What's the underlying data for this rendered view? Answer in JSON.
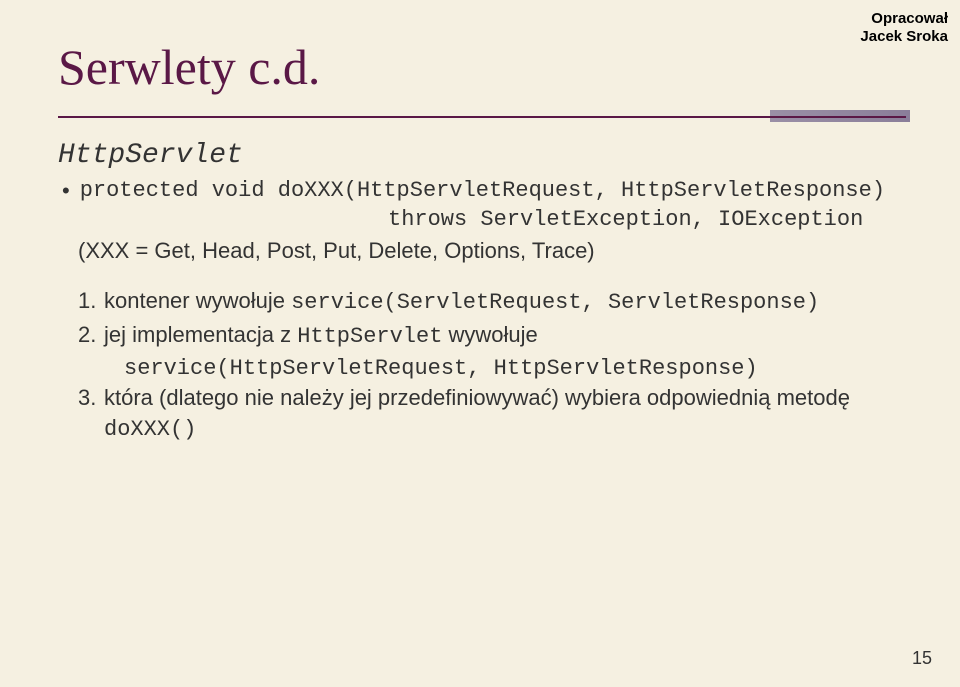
{
  "corner": {
    "line1": "Opracował",
    "line2": "Jacek Sroka"
  },
  "title": "Serwlety c.d.",
  "servlet": {
    "class_name": "HttpServlet",
    "method_sig": "protected void doXXX(HttpServletRequest, HttpServletResponse)",
    "throws_line": "throws ServletException, IOException",
    "xxx_note": "(XXX = Get, Head, Post, Put, Delete, Options, Trace)"
  },
  "items": [
    {
      "num": "1.",
      "pre": "kontener wywołuje ",
      "mono": "service(ServletRequest, ServletResponse)"
    },
    {
      "num": "2.",
      "pre": "jej implementacja z ",
      "mono_inline": "HttpServlet",
      "post": " wywołuje",
      "continuation": "service(HttpServletRequest, HttpServletResponse)"
    },
    {
      "num": "3.",
      "pre": "która (dlatego nie należy jej przedefiniowywać) wybiera odpowiednią metodę ",
      "mono": "doXXX()"
    }
  ],
  "pagenum": "15"
}
